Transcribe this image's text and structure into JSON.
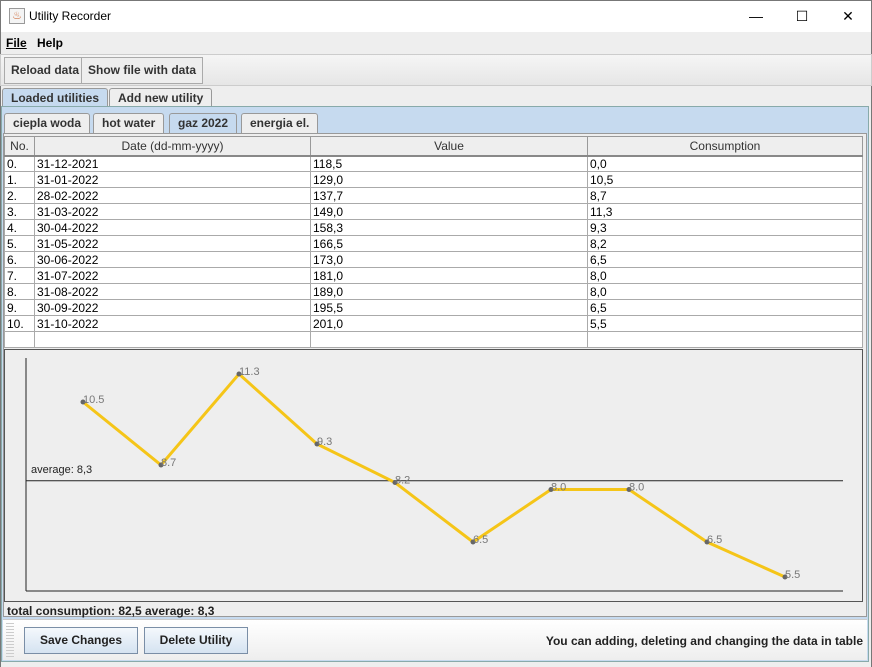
{
  "window": {
    "title": "Utility Recorder",
    "minimize": "—",
    "maximize": "☐",
    "close": "✕"
  },
  "menu": [
    "File",
    "Help"
  ],
  "toolbar": {
    "reload": "Reload data",
    "show_file": "Show file with data"
  },
  "main_tabs": [
    "Loaded utilities",
    "Add new utility"
  ],
  "utility_tabs": [
    "ciepla woda",
    "hot water",
    "gaz 2022",
    "energia el."
  ],
  "selected_utility": "gaz 2022",
  "table": {
    "columns": [
      "No.",
      "Date (dd-mm-yyyy)",
      "Value",
      "Consumption"
    ],
    "rows": [
      [
        "0.",
        "31-12-2021",
        "118,5",
        "0,0"
      ],
      [
        "1.",
        "31-01-2022",
        "129,0",
        "10,5"
      ],
      [
        "2.",
        "28-02-2022",
        "137,7",
        "8,7"
      ],
      [
        "3.",
        "31-03-2022",
        "149,0",
        "11,3"
      ],
      [
        "4.",
        "30-04-2022",
        "158,3",
        "9,3"
      ],
      [
        "5.",
        "31-05-2022",
        "166,5",
        "8,2"
      ],
      [
        "6.",
        "30-06-2022",
        "173,0",
        "6,5"
      ],
      [
        "7.",
        "31-07-2022",
        "181,0",
        "8,0"
      ],
      [
        "8.",
        "31-08-2022",
        "189,0",
        "8,0"
      ],
      [
        "9.",
        "30-09-2022",
        "195,5",
        "6,5"
      ],
      [
        "10.",
        "31-10-2022",
        "201,0",
        "5,5"
      ]
    ]
  },
  "chart_data": {
    "type": "line",
    "x": [
      1,
      2,
      3,
      4,
      5,
      6,
      7,
      8,
      9,
      10
    ],
    "values": [
      10.5,
      8.7,
      11.3,
      9.3,
      8.2,
      6.5,
      8.0,
      8.0,
      6.5,
      5.5
    ],
    "labels": [
      "10.5",
      "8.7",
      "11.3",
      "9.3",
      "8.2",
      "6.5",
      "8.0",
      "8.0",
      "6.5",
      "5.5"
    ],
    "average": 8.25,
    "average_label": "average: 8,3",
    "line_color": "#f5c518",
    "grid": false
  },
  "status": "total consumption: 82,5   average: 8,3",
  "buttons": {
    "save": "Save Changes",
    "delete": "Delete Utility"
  },
  "hint": "You can adding, deleting and changing the data in table"
}
